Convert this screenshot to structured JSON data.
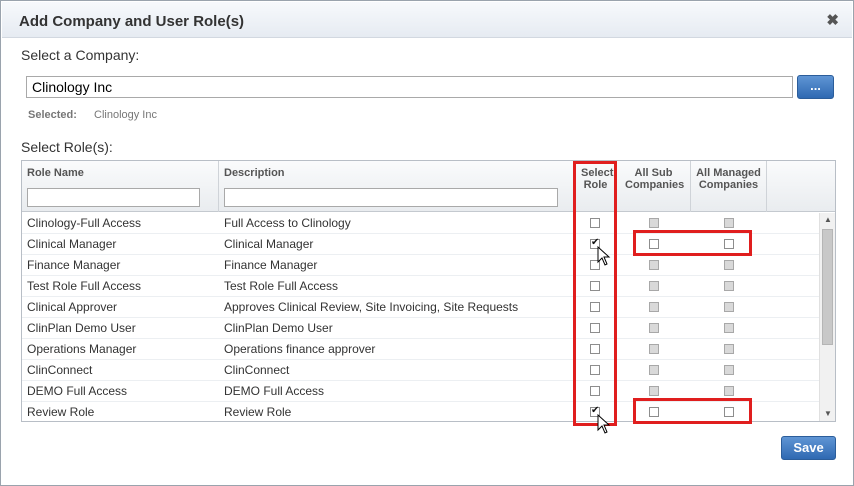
{
  "dialog": {
    "title": "Add Company and User Role(s)",
    "close_icon": "close-icon"
  },
  "company": {
    "label": "Select a Company:",
    "input_value": "Clinology Inc",
    "browse_label": "...",
    "selected_label": "Selected:",
    "selected_value": "Clinology Inc"
  },
  "roles": {
    "label": "Select Role(s):",
    "columns": {
      "role_name": "Role Name",
      "description": "Description",
      "select_role": "Select Role",
      "all_sub": "All Sub Companies",
      "all_managed": "All Managed Companies"
    },
    "rows": [
      {
        "name": "Clinology-Full Access",
        "description": "Full Access to Clinology",
        "selected": false
      },
      {
        "name": "Clinical Manager",
        "description": "Clinical Manager",
        "selected": true
      },
      {
        "name": "Finance Manager",
        "description": "Finance Manager",
        "selected": false
      },
      {
        "name": "Test Role Full Access",
        "description": "Test Role Full Access",
        "selected": false
      },
      {
        "name": "Clinical Approver",
        "description": "Approves Clinical Review, Site Invoicing, Site Requests",
        "selected": false
      },
      {
        "name": "ClinPlan Demo User",
        "description": "ClinPlan Demo User",
        "selected": false
      },
      {
        "name": "Operations Manager",
        "description": "Operations finance approver",
        "selected": false
      },
      {
        "name": "ClinConnect",
        "description": "ClinConnect",
        "selected": false
      },
      {
        "name": "DEMO Full Access",
        "description": "DEMO Full Access",
        "selected": false
      },
      {
        "name": "Review Role",
        "description": "Review Role",
        "selected": true
      }
    ]
  },
  "footer": {
    "save_label": "Save"
  },
  "colors": {
    "accent": "#2f69b2",
    "highlight": "#e01e1e"
  }
}
